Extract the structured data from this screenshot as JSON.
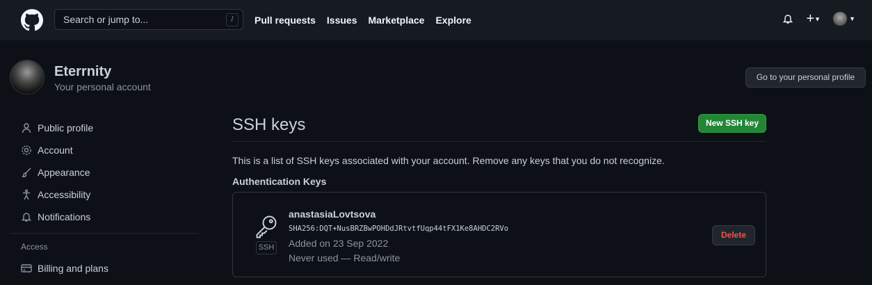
{
  "header": {
    "search_placeholder": "Search or jump to...",
    "slash": "/",
    "nav": [
      "Pull requests",
      "Issues",
      "Marketplace",
      "Explore"
    ]
  },
  "user": {
    "name": "Eterrnity",
    "subtitle": "Your personal account",
    "go_profile": "Go to your personal profile"
  },
  "sidebar": {
    "items": [
      "Public profile",
      "Account",
      "Appearance",
      "Accessibility",
      "Notifications"
    ],
    "section": "Access",
    "access_items": [
      "Billing and plans"
    ]
  },
  "main": {
    "title": "SSH keys",
    "new_button": "New SSH key",
    "description": "This is a list of SSH keys associated with your account. Remove any keys that you do not recognize.",
    "auth_heading": "Authentication Keys",
    "key": {
      "badge": "SSH",
      "name": "anastasiaLovtsova",
      "fingerprint": "SHA256:DQT+NusBRZBwPOHDdJRtvtfUqp44tFX1Ke8AHDC2RVo",
      "added": "Added on 23 Sep 2022",
      "usage": "Never used — Read/write",
      "delete": "Delete"
    }
  }
}
